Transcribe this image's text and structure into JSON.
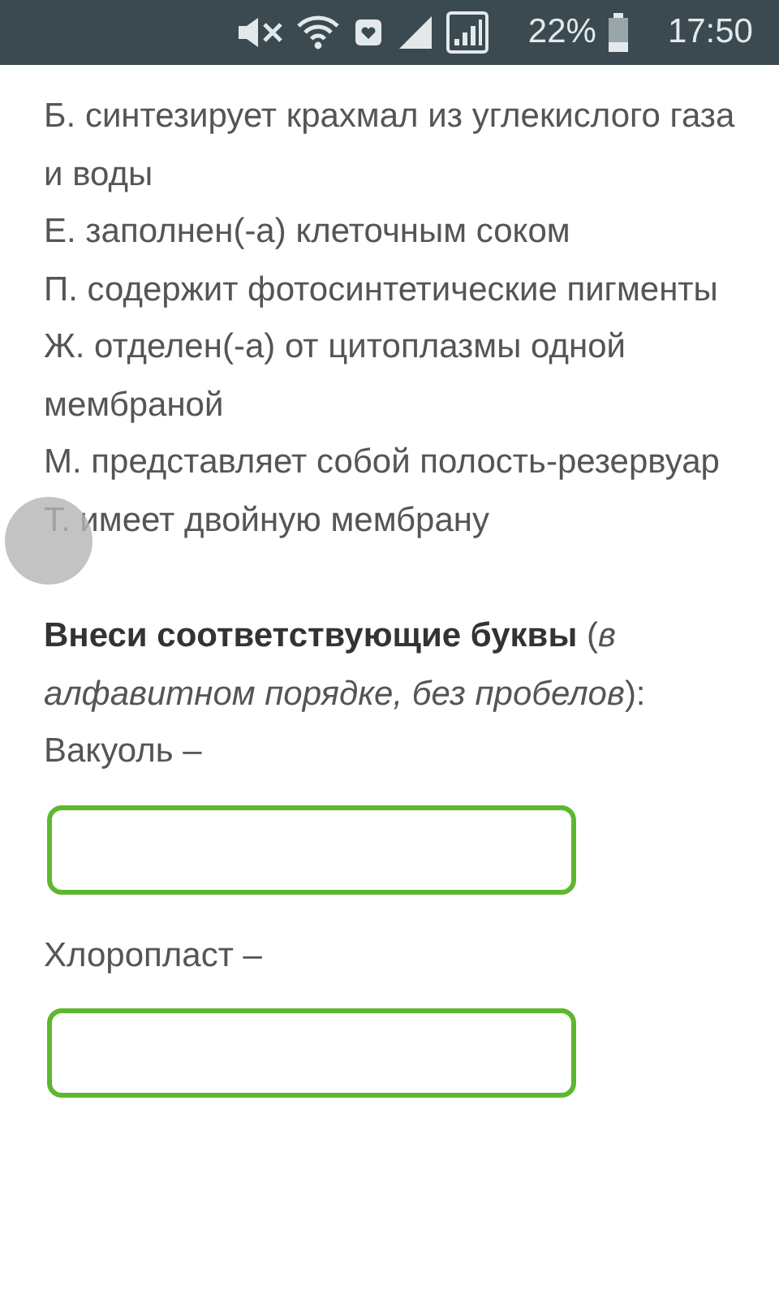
{
  "status_bar": {
    "battery_percent": "22%",
    "time": "17:50"
  },
  "options": [
    "Б. синтезирует крахмал из углекислого газа и воды",
    "Е. заполнен(-а) клеточным соком",
    "П. содержит фотосинтетические пигменты",
    "Ж. отделен(-а) от цитоплазмы одной мембраной",
    "М. представляет собой полость-резервуар",
    "Т. имеет двойную мембрану"
  ],
  "instruction": "**Внеси соответствующие буквы** (*в алфавитном порядке, без пробелов*):",
  "answers": [
    {
      "label": "Вакуоль –"
    },
    {
      "label": "Хлоропласт –"
    }
  ]
}
